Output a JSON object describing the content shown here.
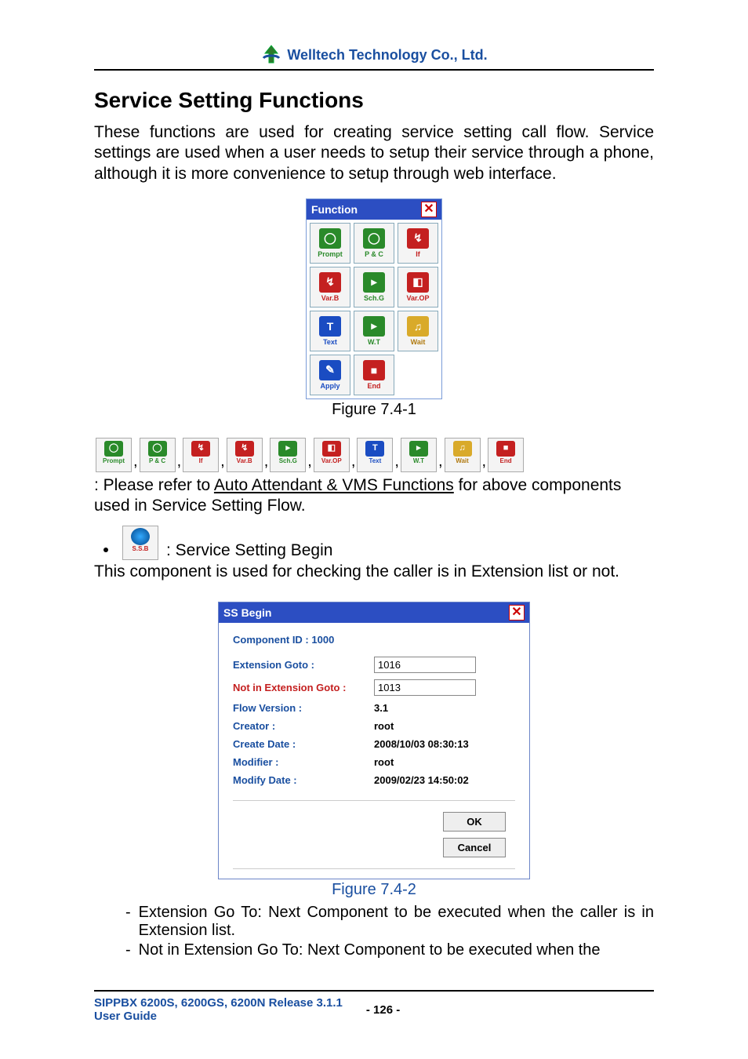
{
  "header": {
    "company": "Welltech Technology Co., Ltd."
  },
  "title": "Service Setting Functions",
  "intro": "These functions are used for creating service setting call flow. Service settings are used when a user needs to setup their service through a phone, although it is more convenience to setup through web interface.",
  "function_panel": {
    "title": "Function",
    "items": [
      {
        "label": "Prompt",
        "color": "g",
        "sym": "◯"
      },
      {
        "label": "P & C",
        "color": "g",
        "sym": "◯"
      },
      {
        "label": "If",
        "color": "r",
        "sym": "↯"
      },
      {
        "label": "Var.B",
        "color": "r",
        "sym": "↯"
      },
      {
        "label": "Sch.G",
        "color": "g",
        "sym": "▸"
      },
      {
        "label": "Var.OP",
        "color": "r",
        "sym": "◧"
      },
      {
        "label": "Text",
        "color": "b",
        "sym": "T"
      },
      {
        "label": "W.T",
        "color": "g",
        "sym": "▸"
      },
      {
        "label": "Wait",
        "color": "y",
        "sym": "♫"
      },
      {
        "label": "Apply",
        "color": "b",
        "sym": "✎"
      },
      {
        "label": "End",
        "color": "r",
        "sym": "■"
      }
    ]
  },
  "fig1": "Figure 7.4-1",
  "icon_row": [
    {
      "label": "Prompt",
      "color": "g",
      "sym": "◯"
    },
    {
      "label": "P & C",
      "color": "g",
      "sym": "◯"
    },
    {
      "label": "If",
      "color": "r",
      "sym": "↯"
    },
    {
      "label": "Var.B",
      "color": "r",
      "sym": "↯"
    },
    {
      "label": "Sch.G",
      "color": "g",
      "sym": "▸"
    },
    {
      "label": "Var.OP",
      "color": "r",
      "sym": "◧"
    },
    {
      "label": "Text",
      "color": "b",
      "sym": "T"
    },
    {
      "label": "W.T",
      "color": "g",
      "sym": "▸"
    },
    {
      "label": "Wait",
      "color": "y",
      "sym": "♫"
    },
    {
      "label": "End",
      "color": "r",
      "sym": "■"
    }
  ],
  "after_icons": {
    "lead": ": Please refer to ",
    "link": "Auto Attendant & VMS Functions",
    "tail": " for above components used in Service Setting Flow."
  },
  "ssb": {
    "icon_label": "S.S.B",
    "caption": ": Service Setting Begin",
    "desc": "This component is used for checking the caller is in Extension list or not."
  },
  "dialog": {
    "title": "SS Begin",
    "component_id": "Component ID : 1000",
    "rows": {
      "ext_goto_label": "Extension Goto :",
      "ext_goto_value": "1016",
      "not_ext_label": "Not in Extension Goto :",
      "not_ext_value": "1013",
      "flow_label": "Flow Version :",
      "flow_value": "3.1",
      "creator_label": "Creator :",
      "creator_value": "root",
      "create_date_label": "Create Date :",
      "create_date_value": "2008/10/03 08:30:13",
      "modifier_label": "Modifier :",
      "modifier_value": "root",
      "modify_date_label": "Modify Date :",
      "modify_date_value": "2009/02/23 14:50:02"
    },
    "ok": "OK",
    "cancel": "Cancel"
  },
  "fig2": "Figure 7.4-2",
  "dash": {
    "a": "Extension Go To: Next Component to be executed when the caller is in Extension list.",
    "b": "Not in Extension Go To: Next Component to be executed when the"
  },
  "footer": {
    "line1a": "SIPPBX 6200S, 6200GS, 6200N Release 3.1.1",
    "line1b": "User Guide",
    "page": "- 126 -"
  }
}
